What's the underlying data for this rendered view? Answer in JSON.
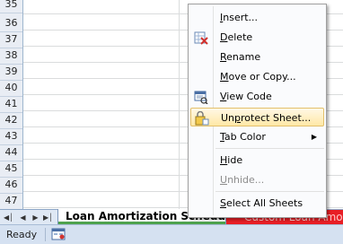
{
  "rows": [
    "35",
    "36",
    "37",
    "38",
    "39",
    "40",
    "41",
    "42",
    "43",
    "44",
    "45",
    "46",
    "47"
  ],
  "context_menu": {
    "items": [
      {
        "id": "insert",
        "label": "Insert...",
        "accel": "I"
      },
      {
        "id": "delete",
        "label": "Delete",
        "accel": "D"
      },
      {
        "id": "rename",
        "label": "Rename",
        "accel": "R"
      },
      {
        "id": "move-or-copy",
        "label": "Move or Copy...",
        "accel": "M"
      },
      {
        "id": "view-code",
        "label": "View Code",
        "accel": "V"
      },
      {
        "id": "unprotect-sheet",
        "label": "Unprotect Sheet...",
        "accel": "p"
      },
      {
        "id": "tab-color",
        "label": "Tab Color",
        "accel": "T"
      },
      {
        "id": "hide",
        "label": "Hide",
        "accel": "H"
      },
      {
        "id": "unhide",
        "label": "Unhide...",
        "accel": "U"
      },
      {
        "id": "select-all-sheets",
        "label": "Select All Sheets",
        "accel": "S"
      }
    ]
  },
  "sheet_tabs": {
    "active": "Loan Amortization Schedule",
    "second": "Custom Loan Amortiz"
  },
  "status": {
    "ready": "Ready"
  },
  "colors": {
    "active_tab_bar": "#4ea24e",
    "second_tab": "#e81e25",
    "menu_highlight": "#ffe8a6"
  }
}
